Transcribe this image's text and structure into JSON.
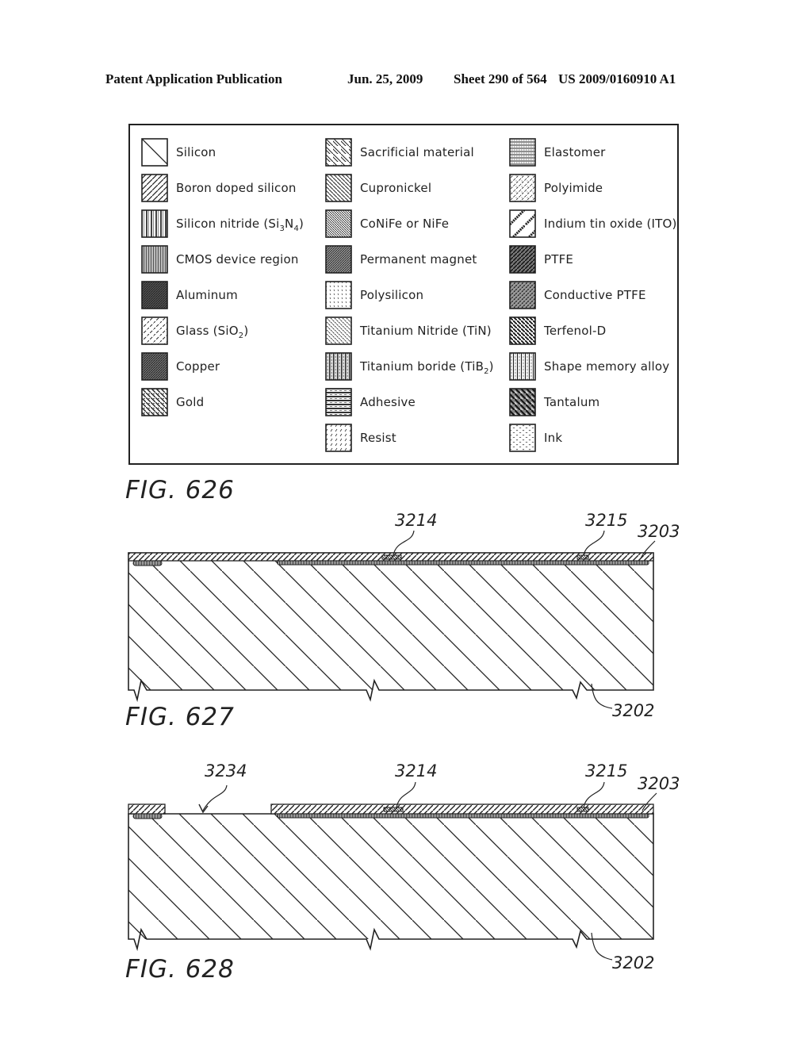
{
  "header": {
    "publication": "Patent Application Publication",
    "date": "Jun. 25, 2009",
    "sheet": "Sheet 290 of 564",
    "number": "US 2009/0160910 A1"
  },
  "legend": {
    "columns": [
      [
        {
          "label": "Silicon",
          "pattern": "silicon"
        },
        {
          "label": "Boron doped silicon",
          "pattern": "boron"
        },
        {
          "label": "Silicon nitride (Si3N4)",
          "pattern": "nitride"
        },
        {
          "label": "CMOS device region",
          "pattern": "cmos"
        },
        {
          "label": "Aluminum",
          "pattern": "aluminum"
        },
        {
          "label": "Glass (SiO2)",
          "pattern": "glass"
        },
        {
          "label": "Copper",
          "pattern": "copper"
        },
        {
          "label": "Gold",
          "pattern": "gold"
        }
      ],
      [
        {
          "label": "Sacrificial material",
          "pattern": "sacrificial"
        },
        {
          "label": "Cupronickel",
          "pattern": "cupronickel"
        },
        {
          "label": "CoNiFe or NiFe",
          "pattern": "conife"
        },
        {
          "label": "Permanent magnet",
          "pattern": "magnet"
        },
        {
          "label": "Polysilicon",
          "pattern": "polysilicon"
        },
        {
          "label": "Titanium Nitride (TiN)",
          "pattern": "tin"
        },
        {
          "label": "Titanium boride (TiB2)",
          "pattern": "tib2"
        },
        {
          "label": "Adhesive",
          "pattern": "adhesive"
        },
        {
          "label": "Resist",
          "pattern": "resist"
        }
      ],
      [
        {
          "label": "Elastomer",
          "pattern": "elastomer"
        },
        {
          "label": "Polyimide",
          "pattern": "polyimide"
        },
        {
          "label": "Indium tin oxide (ITO)",
          "pattern": "ito"
        },
        {
          "label": "PTFE",
          "pattern": "ptfe"
        },
        {
          "label": "Conductive PTFE",
          "pattern": "cptfe"
        },
        {
          "label": "Terfenol-D",
          "pattern": "terfenol"
        },
        {
          "label": "Shape memory alloy",
          "pattern": "sma"
        },
        {
          "label": "Tantalum",
          "pattern": "tantalum"
        },
        {
          "label": "Ink",
          "pattern": "ink"
        }
      ]
    ]
  },
  "figures": {
    "fig626": {
      "label": "FIG. 626"
    },
    "fig627": {
      "label": "FIG. 627",
      "refs": {
        "r3214": "3214",
        "r3215": "3215",
        "r3203": "3203",
        "r3202": "3202"
      }
    },
    "fig628": {
      "label": "FIG. 628",
      "refs": {
        "r3234": "3234",
        "r3214": "3214",
        "r3215": "3215",
        "r3203": "3203",
        "r3202": "3202"
      }
    }
  }
}
